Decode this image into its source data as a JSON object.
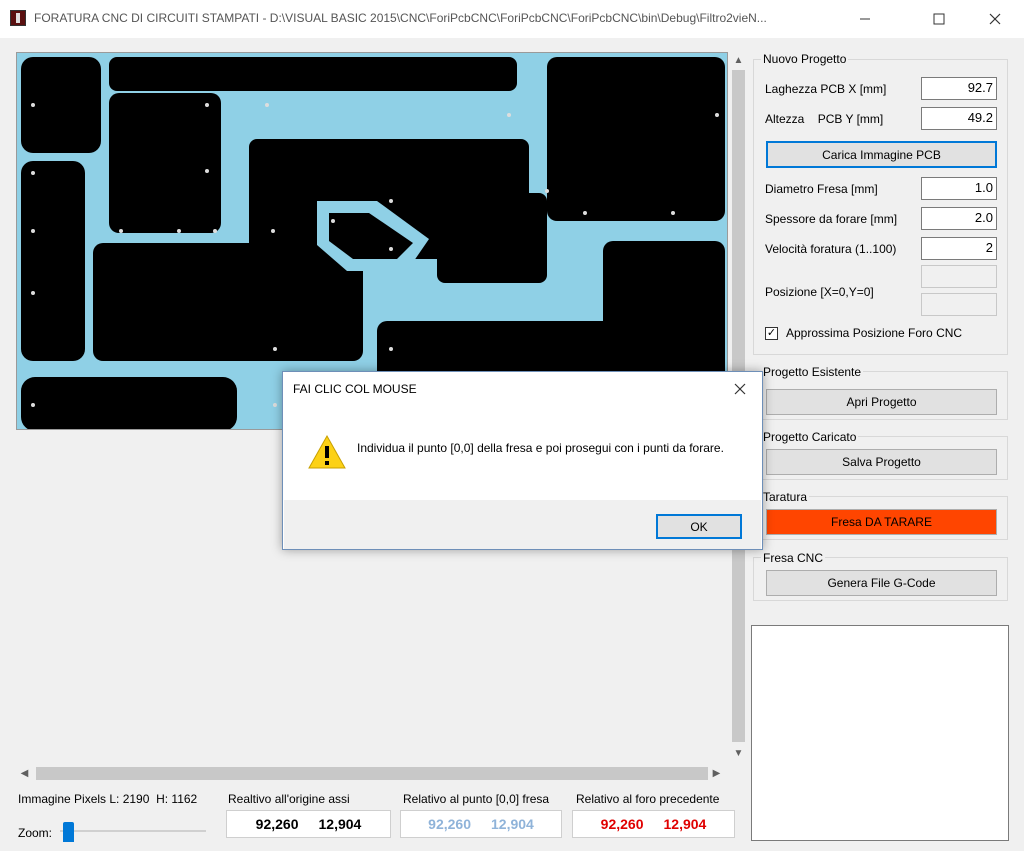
{
  "window": {
    "title": "FORATURA CNC DI CIRCUITI STAMPATI - D:\\VISUAL BASIC 2015\\CNC\\ForiPcbCNC\\ForiPcbCNC\\ForiPcbCNC\\bin\\Debug\\Filtro2vieN...",
    "minimize_icon": "minimize-icon",
    "maximize_icon": "maximize-icon",
    "close_icon": "close-icon"
  },
  "new_project": {
    "legend": "Nuovo Progetto",
    "width_label": "Laghezza PCB X [mm]",
    "width_value": "92.7",
    "height_label": "Altezza    PCB Y [mm]",
    "height_value": "49.2",
    "load_button": "Carica Immagine PCB",
    "cutter_label": "Diametro Fresa [mm]",
    "cutter_value": "1.0",
    "thickness_label": "Spessore da forare [mm]",
    "thickness_value": "2.0",
    "speed_label": "Velocità foratura (1..100)",
    "speed_value": "2",
    "position_label": "Posizione [X=0,Y=0]",
    "approx_label": "Approssima Posizione Foro CNC",
    "approx_checked": true
  },
  "existing_project": {
    "legend": "Progetto Esistente",
    "open_button": "Apri Progetto"
  },
  "loaded_project": {
    "legend": "Progetto Caricato",
    "save_button": "Salva Progetto"
  },
  "calibration": {
    "legend": "Taratura",
    "button": "Fresa DA TARARE",
    "button_color": "#ff4500"
  },
  "cnc": {
    "legend": "Fresa CNC",
    "button": "Genera File G-Code"
  },
  "image_info": {
    "label": "Immagine Pixels L: 2190  H: 1162",
    "zoom_label": "Zoom:"
  },
  "coords": {
    "origin": {
      "label": "Realtivo all'origine assi",
      "x": "92,260",
      "y": "12,904",
      "color": "#000000"
    },
    "point": {
      "label": "Relativo al punto [0,0] fresa",
      "x": "92,260",
      "y": "12,904",
      "color": "#8fb3d9"
    },
    "previous": {
      "label": "Relativo al foro precedente",
      "x": "92,260",
      "y": "12,904",
      "color": "#e00000"
    }
  },
  "dialog": {
    "title": "FAI CLIC COL MOUSE",
    "message": "Individua il punto [0,0] della fresa e poi prosegui con i punti da forare.",
    "ok_button": "OK",
    "icon": "warning-icon"
  },
  "colors": {
    "pcb_copper": "#000000",
    "pcb_substrate": "#8fd0e6",
    "accent": "#0078d7"
  }
}
